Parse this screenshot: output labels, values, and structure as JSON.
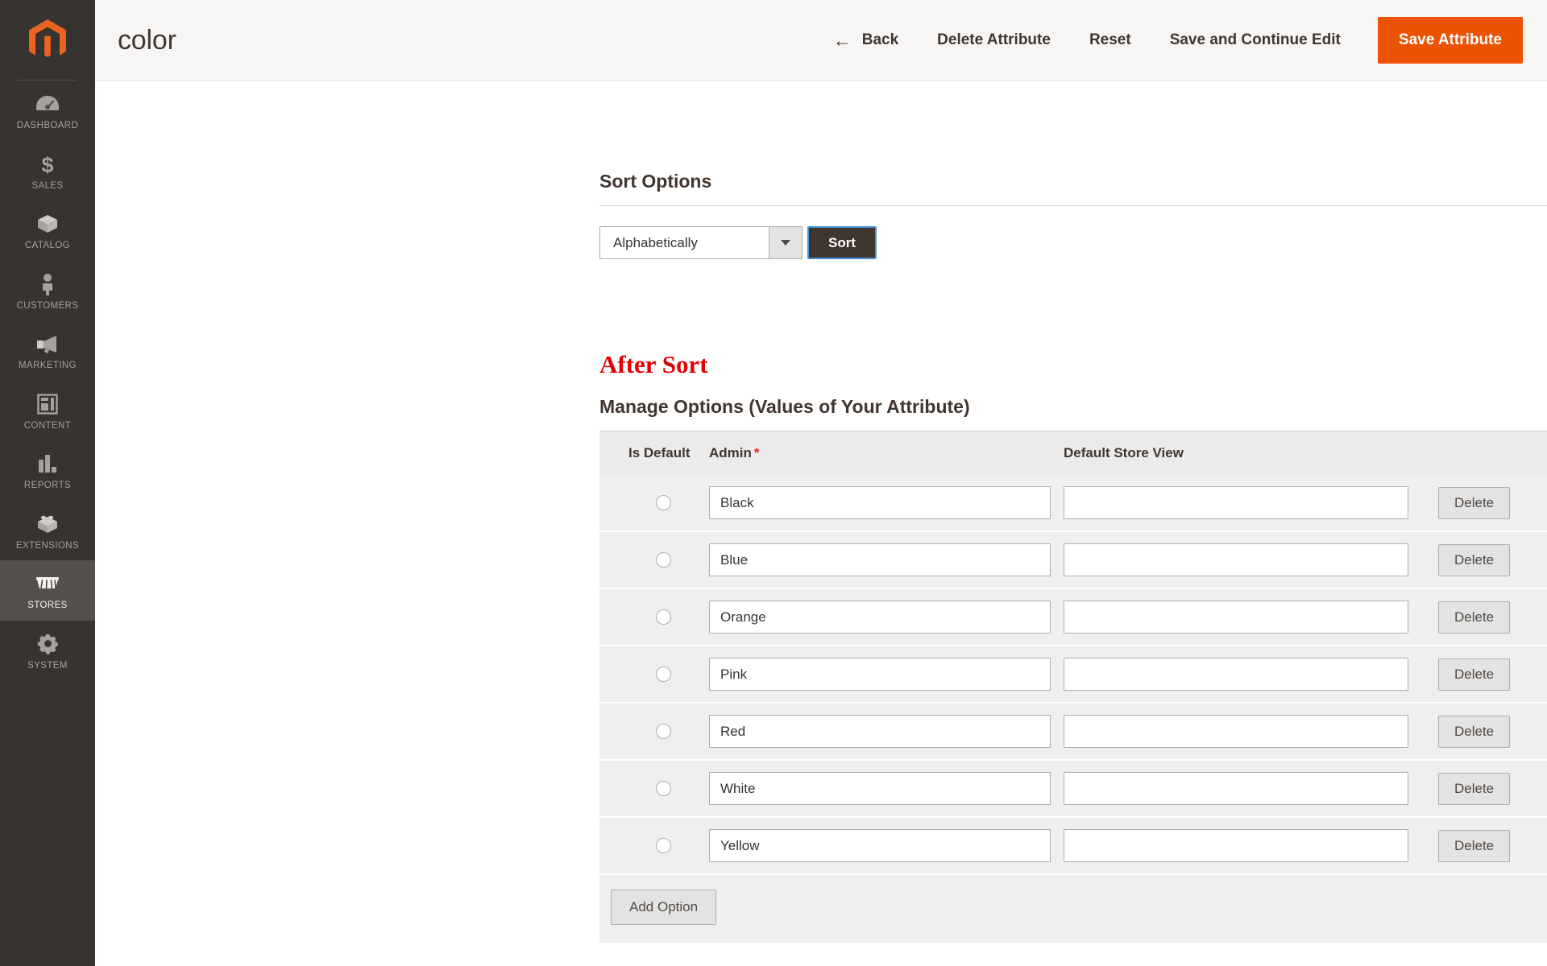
{
  "sidebar": {
    "logo_icon": "magento-logo-icon",
    "items": [
      {
        "label": "DASHBOARD",
        "icon": "dashboard-gauge-icon",
        "active": false
      },
      {
        "label": "SALES",
        "icon": "dollar-sign-icon",
        "active": false
      },
      {
        "label": "CATALOG",
        "icon": "box-icon",
        "active": false
      },
      {
        "label": "CUSTOMERS",
        "icon": "person-icon",
        "active": false
      },
      {
        "label": "MARKETING",
        "icon": "megaphone-icon",
        "active": false
      },
      {
        "label": "CONTENT",
        "icon": "layout-page-icon",
        "active": false
      },
      {
        "label": "REPORTS",
        "icon": "bar-chart-icon",
        "active": false
      },
      {
        "label": "EXTENSIONS",
        "icon": "lego-brick-icon",
        "active": false
      },
      {
        "label": "STORES",
        "icon": "storefront-awning-icon",
        "active": true
      },
      {
        "label": "SYSTEM",
        "icon": "gear-icon",
        "active": false
      }
    ]
  },
  "header": {
    "title": "color",
    "back_label": "Back",
    "back_icon": "arrow-left-icon",
    "delete_attribute_label": "Delete Attribute",
    "reset_label": "Reset",
    "save_continue_label": "Save and Continue Edit",
    "save_label": "Save Attribute",
    "primary_color": "#eb5202"
  },
  "sort_options": {
    "title": "Sort Options",
    "select_value": "Alphabetically",
    "select_options": [
      "Alphabetically"
    ],
    "dropdown_icon": "chevron-down-icon",
    "sort_button_label": "Sort"
  },
  "annotation": {
    "after_sort_label": "After Sort",
    "color": "#e00000"
  },
  "manage_options": {
    "title": "Manage Options (Values of Your Attribute)",
    "columns": {
      "is_default": "Is Default",
      "admin": "Admin",
      "admin_required_marker": "*",
      "default_store_view": "Default Store View"
    },
    "delete_label": "Delete",
    "add_option_label": "Add Option",
    "drag_handle_icon": "drag-handle-dots-icon",
    "rows": [
      {
        "is_default": false,
        "admin": "Black",
        "default_store_view": ""
      },
      {
        "is_default": false,
        "admin": "Blue",
        "default_store_view": ""
      },
      {
        "is_default": false,
        "admin": "Orange",
        "default_store_view": ""
      },
      {
        "is_default": false,
        "admin": "Pink",
        "default_store_view": ""
      },
      {
        "is_default": false,
        "admin": "Red",
        "default_store_view": ""
      },
      {
        "is_default": false,
        "admin": "White",
        "default_store_view": ""
      },
      {
        "is_default": false,
        "admin": "Yellow",
        "default_store_view": ""
      }
    ]
  }
}
